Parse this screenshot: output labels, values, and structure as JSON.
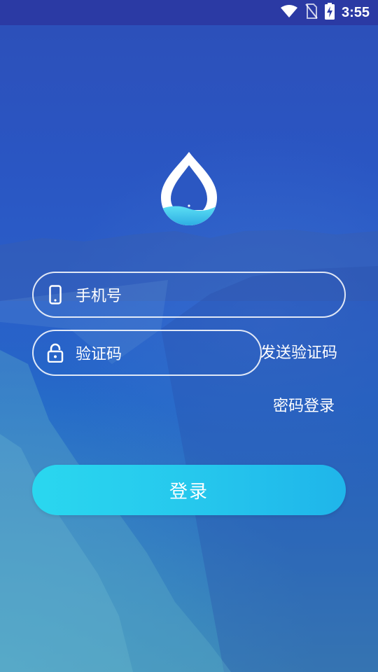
{
  "status_bar": {
    "time": "3:55"
  },
  "form": {
    "phone_placeholder": "手机号",
    "code_placeholder": "验证码",
    "send_code": "发送验证码",
    "password_login": "密码登录",
    "login_button": "登录"
  },
  "colors": {
    "status_bar": "#2b3aa4",
    "background_top": "#2d4fb8",
    "button_start": "#2ad7ef",
    "button_end": "#1fb5ea"
  },
  "icons": {
    "wifi": "wifi-icon",
    "no_sim": "no-sim-icon",
    "battery": "battery-charging-icon",
    "phone": "phone-icon",
    "lock": "lock-icon",
    "logo": "water-drop-logo"
  }
}
